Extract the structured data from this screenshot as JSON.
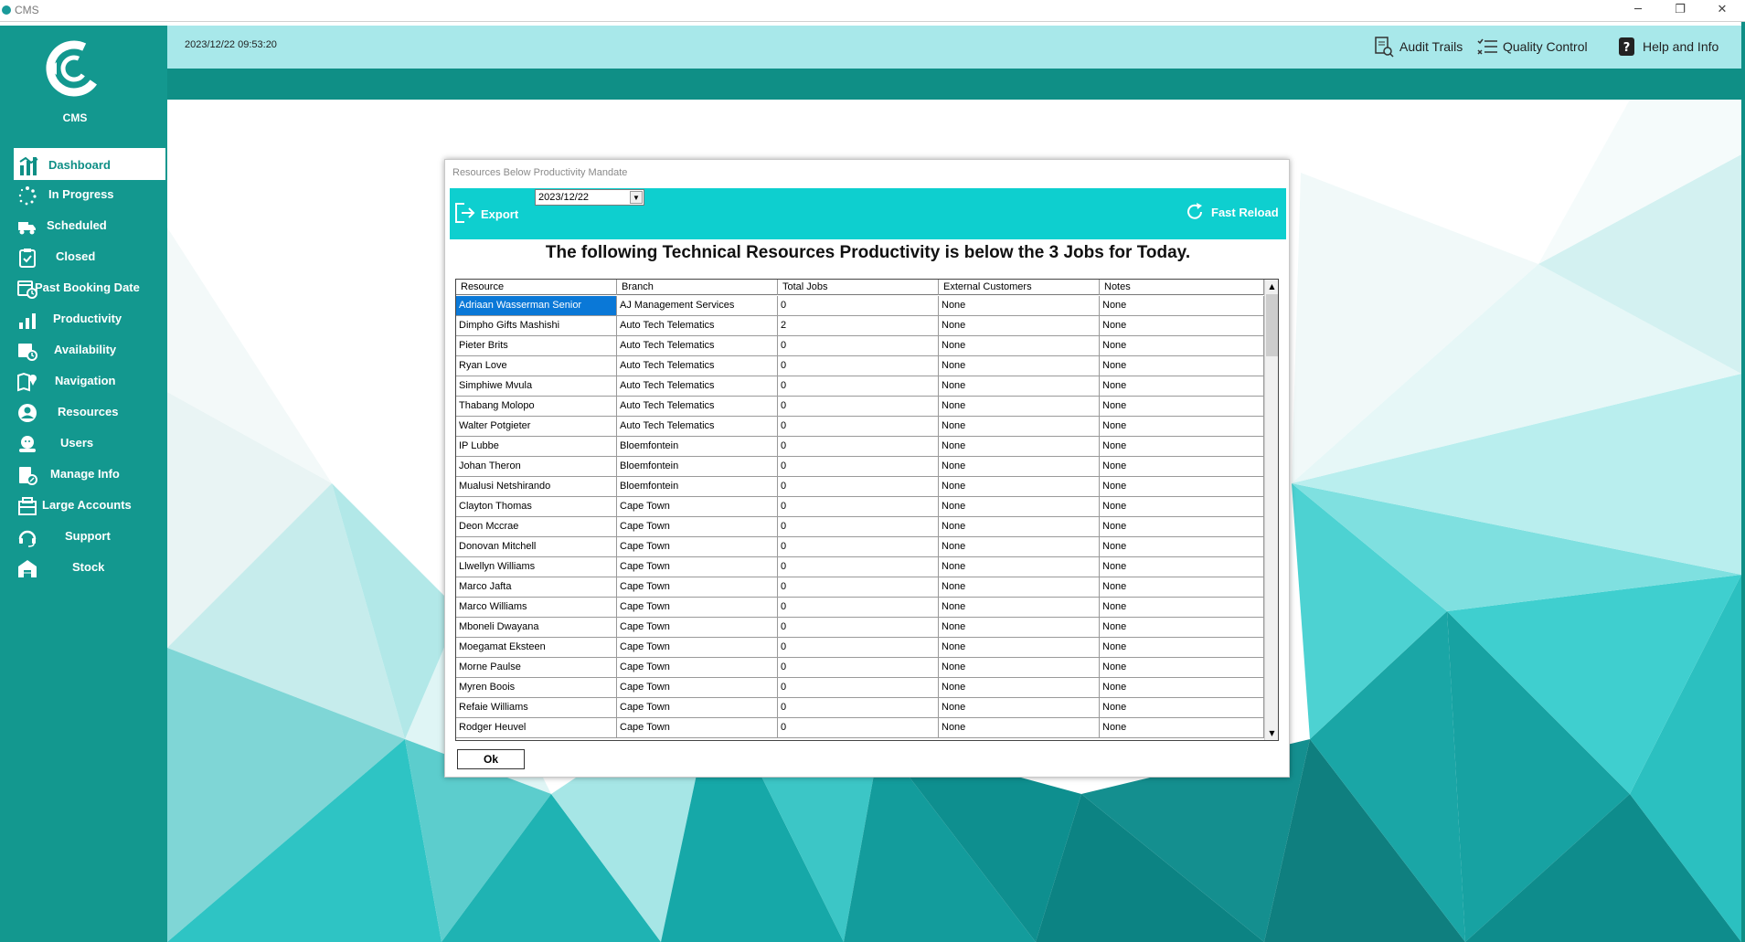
{
  "window": {
    "title": "CMS",
    "minimize": "─",
    "maximize": "❐",
    "close": "✕"
  },
  "sidebar": {
    "brand": "CMS",
    "items": [
      {
        "label": "Dashboard",
        "icon": "dashboard-icon"
      },
      {
        "label": "In Progress",
        "icon": "spinner-icon"
      },
      {
        "label": "Scheduled",
        "icon": "truck-icon"
      },
      {
        "label": "Closed",
        "icon": "clipboard-check-icon"
      },
      {
        "label": "Past Booking Date",
        "icon": "calendar-clock-icon"
      },
      {
        "label": "Productivity",
        "icon": "bar-chart-icon"
      },
      {
        "label": "Availability",
        "icon": "calendar-time-icon"
      },
      {
        "label": "Navigation",
        "icon": "map-pin-icon"
      },
      {
        "label": "Resources",
        "icon": "user-circle-icon"
      },
      {
        "label": "Users",
        "icon": "users-icon"
      },
      {
        "label": "Manage Info",
        "icon": "edit-file-icon"
      },
      {
        "label": "Large Accounts",
        "icon": "building-icon"
      },
      {
        "label": "Support",
        "icon": "headset-icon"
      },
      {
        "label": "Stock",
        "icon": "warehouse-icon"
      }
    ]
  },
  "header": {
    "datetime": "2023/12/22 09:53:20",
    "links": [
      {
        "label": "Audit Trails",
        "icon": "audit-doc-icon"
      },
      {
        "label": "Quality Control",
        "icon": "checklist-icon"
      },
      {
        "label": "Help and Info",
        "icon": "help-icon"
      }
    ]
  },
  "dialog": {
    "title": "Resources Below Productivity Mandate",
    "export_label": "Export",
    "date_value": "2023/12/22",
    "reload_label": "Fast Reload",
    "heading": "The following Technical Resources Productivity is below the 3 Jobs for Today.",
    "ok_label": "Ok",
    "columns": [
      "Resource",
      "Branch",
      "Total Jobs",
      "External Customers",
      "Notes"
    ],
    "rows": [
      [
        "Adriaan Wasserman Senior",
        "AJ Management Services",
        "0",
        "None",
        "None"
      ],
      [
        "Dimpho Gifts Mashishi",
        "Auto Tech Telematics",
        "2",
        "None",
        "None"
      ],
      [
        "Pieter Brits",
        "Auto Tech Telematics",
        "0",
        "None",
        "None"
      ],
      [
        "Ryan Love",
        "Auto Tech Telematics",
        "0",
        "None",
        "None"
      ],
      [
        "Simphiwe Mvula",
        "Auto Tech Telematics",
        "0",
        "None",
        "None"
      ],
      [
        "Thabang Molopo",
        "Auto Tech Telematics",
        "0",
        "None",
        "None"
      ],
      [
        "Walter Potgieter",
        "Auto Tech Telematics",
        "0",
        "None",
        "None"
      ],
      [
        "IP Lubbe",
        "Bloemfontein",
        "0",
        "None",
        "None"
      ],
      [
        "Johan Theron",
        "Bloemfontein",
        "0",
        "None",
        "None"
      ],
      [
        "Mualusi Netshirando",
        "Bloemfontein",
        "0",
        "None",
        "None"
      ],
      [
        "Clayton Thomas",
        "Cape Town",
        "0",
        "None",
        "None"
      ],
      [
        "Deon Mccrae",
        "Cape Town",
        "0",
        "None",
        "None"
      ],
      [
        "Donovan Mitchell",
        "Cape Town",
        "0",
        "None",
        "None"
      ],
      [
        "Llwellyn Williams",
        "Cape Town",
        "0",
        "None",
        "None"
      ],
      [
        "Marco Jafta",
        "Cape Town",
        "0",
        "None",
        "None"
      ],
      [
        "Marco Williams",
        "Cape Town",
        "0",
        "None",
        "None"
      ],
      [
        "Mboneli Dwayana",
        "Cape Town",
        "0",
        "None",
        "None"
      ],
      [
        "Moegamat Eksteen",
        "Cape Town",
        "0",
        "None",
        "None"
      ],
      [
        "Morne Paulse",
        "Cape Town",
        "0",
        "None",
        "None"
      ],
      [
        "Myren Boois",
        "Cape Town",
        "0",
        "None",
        "None"
      ],
      [
        "Refaie Williams",
        "Cape Town",
        "0",
        "None",
        "None"
      ],
      [
        "Rodger Heuvel",
        "Cape Town",
        "0",
        "None",
        "None"
      ]
    ],
    "selected_row": 0
  },
  "colors": {
    "sidebar": "#13988f",
    "header_light": "#a8e8ea",
    "header_dark": "#0f8f86",
    "dialog_toolbar": "#0ecfcf",
    "selection": "#0a78d7"
  }
}
